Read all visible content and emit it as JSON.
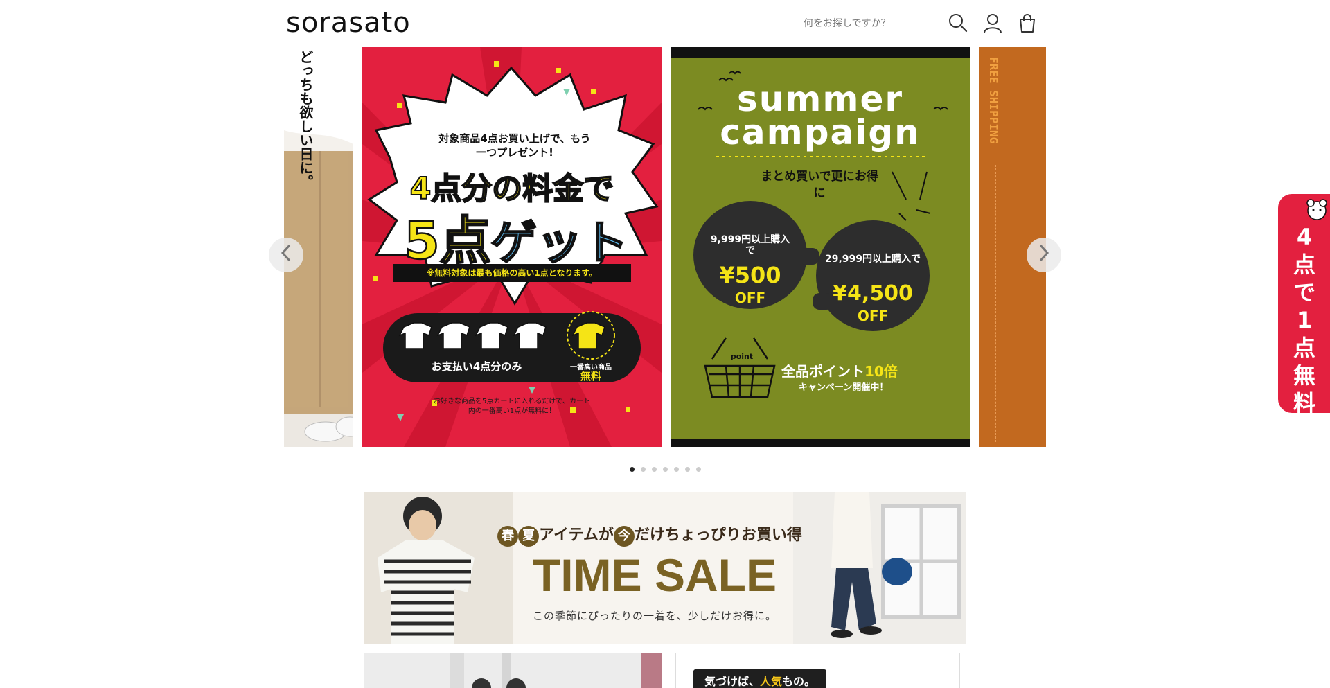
{
  "header": {
    "logo": "sorasato",
    "search_placeholder": "何をお探しですか？"
  },
  "carousel": {
    "left_partial": {
      "vertical_text": "どっちも欲しい日に。"
    },
    "red_slide": {
      "top_text": "対象商品4点お買い上げで、もう一つプレゼント!",
      "headline_line1": "4点分の料金で",
      "headline_line2_a": "5点",
      "headline_line2_b": "ゲット",
      "note": "※無料対象は最も価格の高い1点となります。",
      "pay_label": "お支払い4点分のみ",
      "free_label_small": "一番高い商品",
      "free_label": "無料",
      "footer_text": "お好きな商品を5点カートに入れるだけで、カート内の一番高い1点が無料に！"
    },
    "green_slide": {
      "title_line1": "summer",
      "title_line2": "campaign",
      "subtitle": "まとめ買いで更にお得に",
      "left_cond": "9,999円以上購入で",
      "left_amount": "¥500",
      "left_off": "OFF",
      "right_cond": "29,999円以上購入で",
      "right_amount": "¥4,500",
      "right_off": "OFF",
      "basket_label": "point",
      "points_a": "全品ポイント",
      "points_b": "10倍",
      "points_sub": "キャンペーン開催中！"
    },
    "right_partial": {
      "vertical_text": "FREE SHIPPING"
    },
    "dots_count": 7,
    "active_dot": 0
  },
  "side_tab": {
    "text": "4点で1点無料"
  },
  "timesale": {
    "sub_a": "春",
    "sub_b": "夏",
    "sub_c": "アイテムが",
    "sub_d": "今",
    "sub_e": "だけちょっぴりお買い得",
    "title": "TIME SALE",
    "caption": "この季節にぴったりの一着を、少しだけお得に。"
  },
  "bottom": {
    "pill_a": "気づけば、",
    "pill_b": "人気",
    "pill_c": "もの。"
  },
  "colors": {
    "red": "#e3203f",
    "green": "#7c8b22",
    "orange": "#c2691f",
    "yellow": "#f5e416",
    "blue": "#5ab4e6",
    "gold": "#7a6224"
  }
}
